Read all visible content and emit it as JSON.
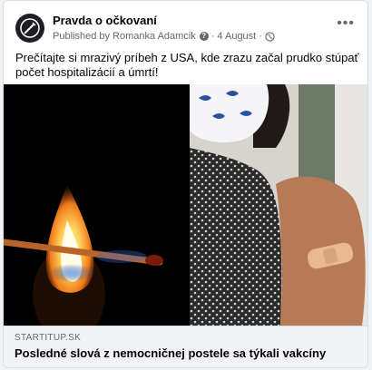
{
  "post": {
    "page_name": "Pravda o očkovaní",
    "published_by": "Published by Romanka Adamcik",
    "date": "4 August",
    "audience_icon": "globe-icon",
    "text": "Prečítajte si mrazivý príbeh z USA, kde zrazu začal prudko stúpať počet hospitalizácií a úmrtí!"
  },
  "link_preview": {
    "domain": "STARTITUP.SK",
    "headline": "Posledné slová z nemocničnej postele sa týkali vakcíny"
  },
  "colors": {
    "text_primary": "#050505",
    "text_secondary": "#65676b",
    "footer_bg": "#f0f2f5"
  }
}
